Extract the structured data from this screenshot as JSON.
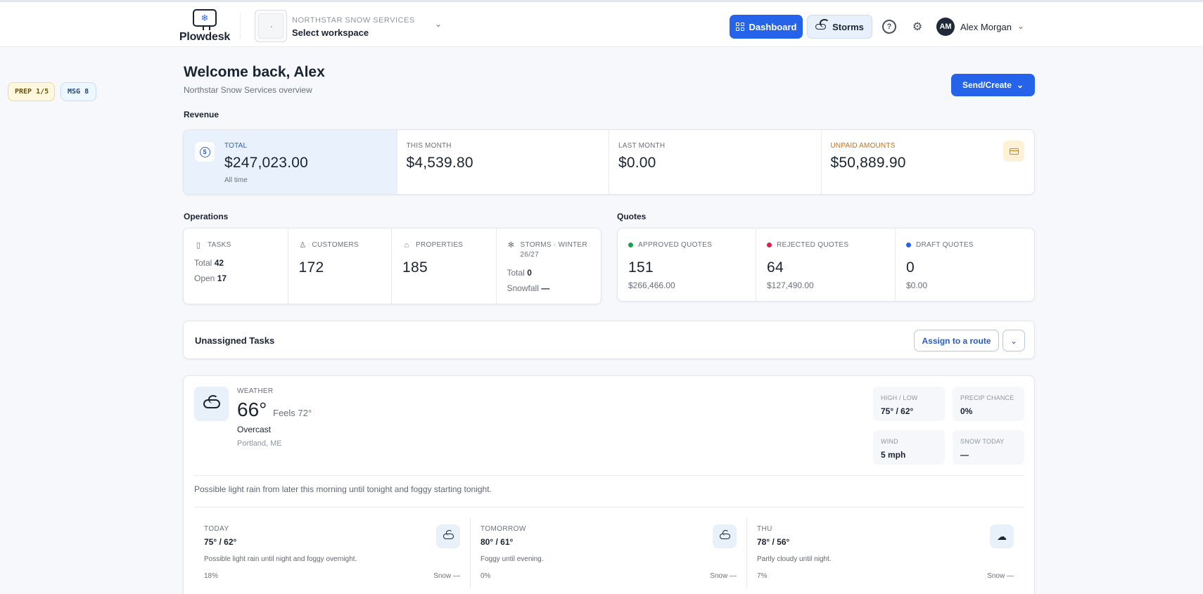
{
  "app": {
    "name": "Plowdesk",
    "logo_glyph": "❄"
  },
  "workspace": {
    "company": "NORTHSTAR SNOW SERVICES",
    "selector_label": "Select workspace"
  },
  "nav": {
    "dashboard": "Dashboard",
    "storms": "Storms",
    "help_glyph": "?",
    "settings_glyph": "⚙",
    "user_initials": "AM",
    "user_name": "Alex Morgan"
  },
  "chips": {
    "prep_label": "PREP",
    "prep_value": "1/5",
    "msg_label": "MSG",
    "msg_value": "8"
  },
  "header": {
    "title": "Welcome back, Alex",
    "subtitle": "Northstar Snow Services overview",
    "send_create": "Send/Create"
  },
  "revenue": {
    "section": "Revenue",
    "total_label": "TOTAL",
    "total_value": "$247,023.00",
    "total_sub": "All time",
    "this_month_label": "THIS MONTH",
    "this_month_value": "$4,539.80",
    "last_month_label": "LAST MONTH",
    "last_month_value": "$0.00",
    "unpaid_label": "UNPAID AMOUNTS",
    "unpaid_value": "$50,889.90"
  },
  "operations": {
    "section": "Operations",
    "tasks_label": "TASKS",
    "tasks_total_label": "Total",
    "tasks_total": "42",
    "tasks_open_label": "Open",
    "tasks_open": "17",
    "customers_label": "CUSTOMERS",
    "customers_value": "172",
    "properties_label": "PROPERTIES",
    "properties_value": "185",
    "storms_label_1": "STORMS · WINTER",
    "storms_label_2": "26/27",
    "storms_total_label": "Total",
    "storms_total": "0",
    "snowfall_label": "Snowfall",
    "snowfall_value": "—"
  },
  "quotes": {
    "section": "Quotes",
    "approved_label": "APPROVED QUOTES",
    "approved_count": "151",
    "approved_amount": "$266,466.00",
    "rejected_label": "REJECTED QUOTES",
    "rejected_count": "64",
    "rejected_amount": "$127,490.00",
    "draft_label": "DRAFT QUOTES",
    "draft_count": "0",
    "draft_amount": "$0.00",
    "colors": {
      "approved": "#16a34a",
      "rejected": "#e11d48",
      "draft": "#2563eb"
    }
  },
  "unassigned": {
    "title": "Unassigned Tasks",
    "assign_button": "Assign to a route",
    "expand_glyph": "⌄"
  },
  "weather": {
    "label": "WEATHER",
    "temperature": "66°",
    "feels": "Feels 72°",
    "condition": "Overcast",
    "location": "Portland, ME",
    "high_low_label": "HIGH / LOW",
    "high_low_value": "75° / 62°",
    "precip_label": "PRECIP CHANCE",
    "precip_value": "0%",
    "wind_label": "WIND",
    "wind_value": "5 mph",
    "snow_label": "SNOW TODAY",
    "snow_value": "—",
    "summary": "Possible light rain from later this morning until tonight and foggy starting tonight.",
    "forecast": [
      {
        "day": "TODAY",
        "temp": "75° / 62°",
        "desc": "Possible light rain until night and foggy overnight.",
        "pct": "18%",
        "snow": "Snow —",
        "icon": "cloud-icon"
      },
      {
        "day": "TOMORROW",
        "temp": "80° / 61°",
        "desc": "Foggy until evening.",
        "pct": "0%",
        "snow": "Snow —",
        "icon": "cloud-icon"
      },
      {
        "day": "THU",
        "temp": "78° / 56°",
        "desc": "Partly cloudy until night.",
        "pct": "7%",
        "snow": "Snow —",
        "icon": "partly-cloudy-icon"
      }
    ]
  }
}
